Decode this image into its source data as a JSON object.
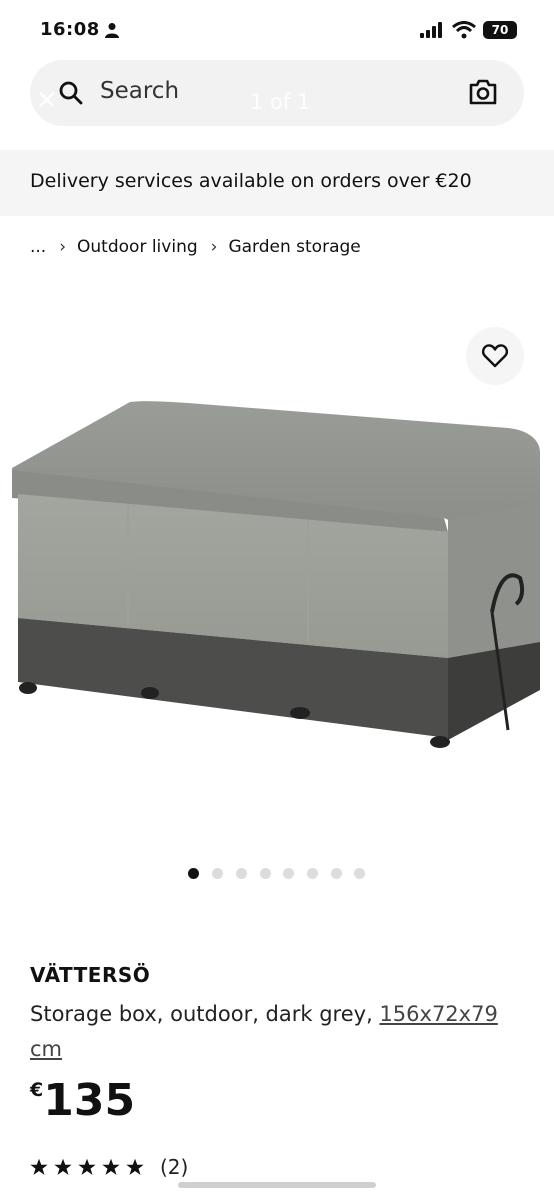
{
  "status_bar": {
    "time": "16:08",
    "battery": "70"
  },
  "search": {
    "placeholder": "Search",
    "ghost_close": "✕",
    "ghost_count": "1 of 1"
  },
  "delivery": {
    "text": "Delivery services available on orders over €20"
  },
  "breadcrumb": {
    "ellipsis": "...",
    "items": [
      "Outdoor living",
      "Garden storage"
    ]
  },
  "gallery": {
    "image_count": 8,
    "active_index": 0
  },
  "product": {
    "name": "VÄTTERSÖ",
    "description": "Storage box, outdoor, dark grey, ",
    "size": "156x72x79 cm",
    "currency": "€",
    "price": "135",
    "rating": 5,
    "reviews": "(2)"
  },
  "icons": {
    "search": "search-icon",
    "camera": "camera-icon",
    "heart": "heart-icon",
    "chevron": "chevron-right-icon",
    "star": "star-icon"
  }
}
